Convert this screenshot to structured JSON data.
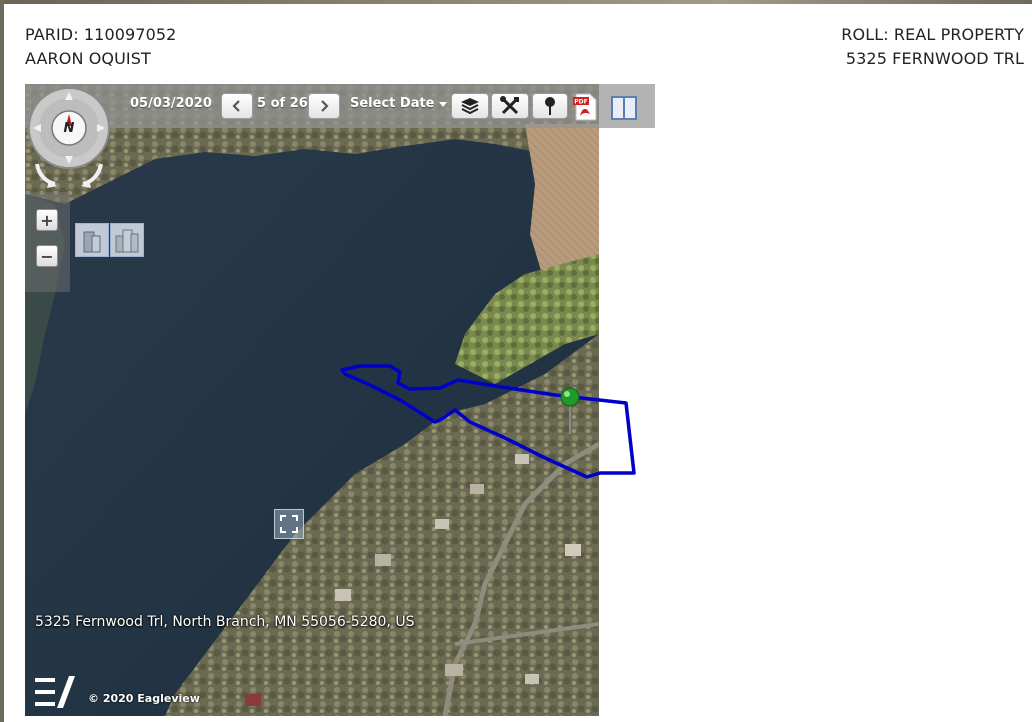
{
  "header": {
    "parid": "PARID: 110097052",
    "owner": "AARON OQUIST",
    "roll": "ROLL: REAL PROPERTY",
    "address": "5325 FERNWOOD TRL"
  },
  "toolbar": {
    "date": "05/03/2020",
    "count": "5 of 26",
    "select_date": "Select Date",
    "prev_icon": "chevron-left-icon",
    "next_icon": "chevron-right-icon",
    "layers_icon": "layers-icon",
    "tools_icon": "tools-icon",
    "pin_icon": "pushpin-icon",
    "pdf_icon": "pdf-icon",
    "split_icon": "split-view-icon"
  },
  "navigation": {
    "compass_label": "N",
    "zoom_in": "+",
    "zoom_out": "−"
  },
  "map": {
    "address_label": "5325 Fernwood Trl, North Branch, MN 55056-5280, US",
    "copyright": "© 2020 Eagleview",
    "parcel_color": "#0000c8",
    "pin_color": "#1f9a2a"
  }
}
